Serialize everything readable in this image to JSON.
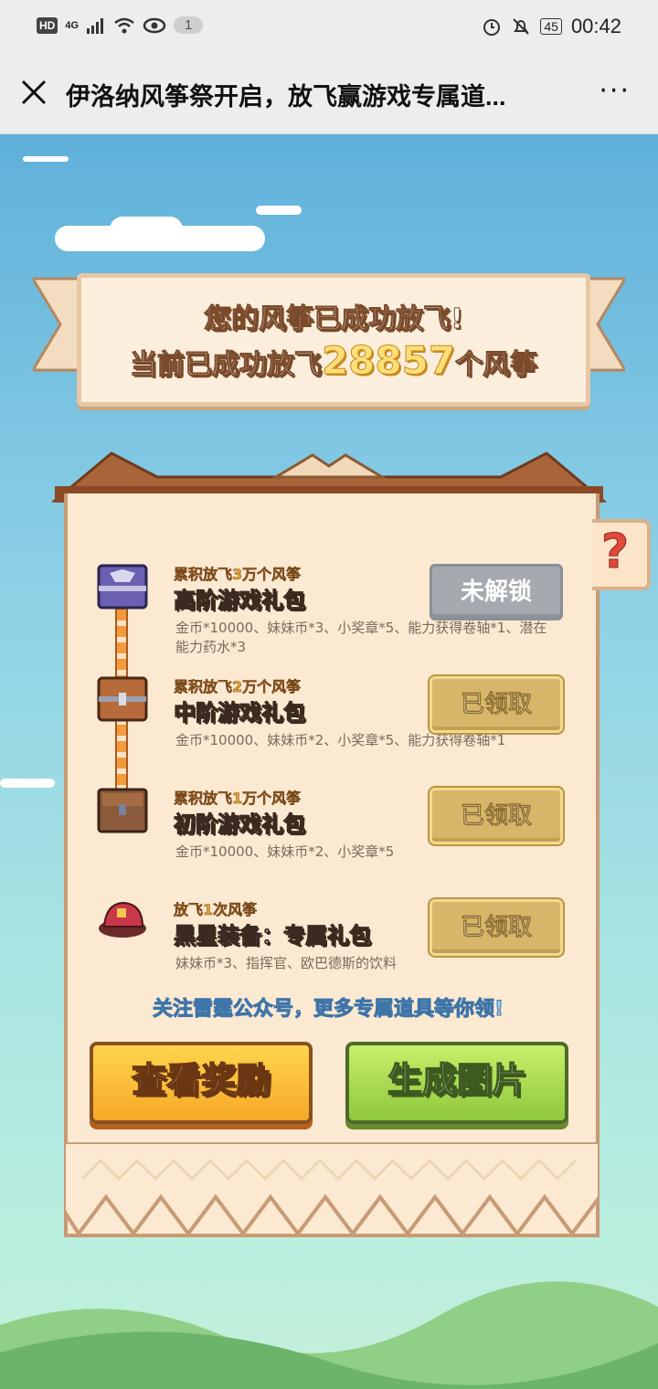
{
  "statusbar": {
    "left_hd": "HD",
    "left_network": "4G",
    "left_badge": "1",
    "battery": "45",
    "time": "00:42"
  },
  "nav": {
    "title": "伊洛纳风筝祭开启，放飞赢游戏专属道...",
    "more": "···"
  },
  "banner": {
    "line1": "您的风筝已成功放飞!",
    "line2_prefix": "当前已成功放飞",
    "count": "28857",
    "line2_suffix": "个风筝"
  },
  "help_label": "?",
  "rewards": [
    {
      "requirement": "累积放飞3万个风筝",
      "name": "高阶游戏礼包",
      "desc": "金币*10000、妹妹币*3、小奖章*5、能力获得卷轴*1、潜在能力药水*3",
      "button": "未解锁",
      "state": "locked"
    },
    {
      "requirement": "累积放飞2万个风筝",
      "name": "中阶游戏礼包",
      "desc": "金币*10000、妹妹币*2、小奖章*5、能力获得卷轴*1",
      "button": "已领取",
      "state": "claimed"
    },
    {
      "requirement": "累积放飞1万个风筝",
      "name": "初阶游戏礼包",
      "desc": "金币*10000、妹妹币*2、小奖章*5",
      "button": "已领取",
      "state": "claimed"
    },
    {
      "requirement": "放飞1次风筝",
      "name": "黑星装备：专属礼包",
      "desc": "妹妹币*3、指挥官、欧巴德斯的饮料",
      "button": "已领取",
      "state": "claimed"
    }
  ],
  "notice": "关注雷霆公众号，更多专属道具等你领!",
  "buttons": {
    "view_rewards": "查看奖励",
    "generate_image": "生成图片"
  },
  "colors": {
    "sky_top": "#5fb0da",
    "panel_bg": "#fbe9d2",
    "claimed_button": "#d7b66a",
    "locked_button": "#a5aab0",
    "orange_button": "#f6a828",
    "green_button": "#8fc83c"
  }
}
